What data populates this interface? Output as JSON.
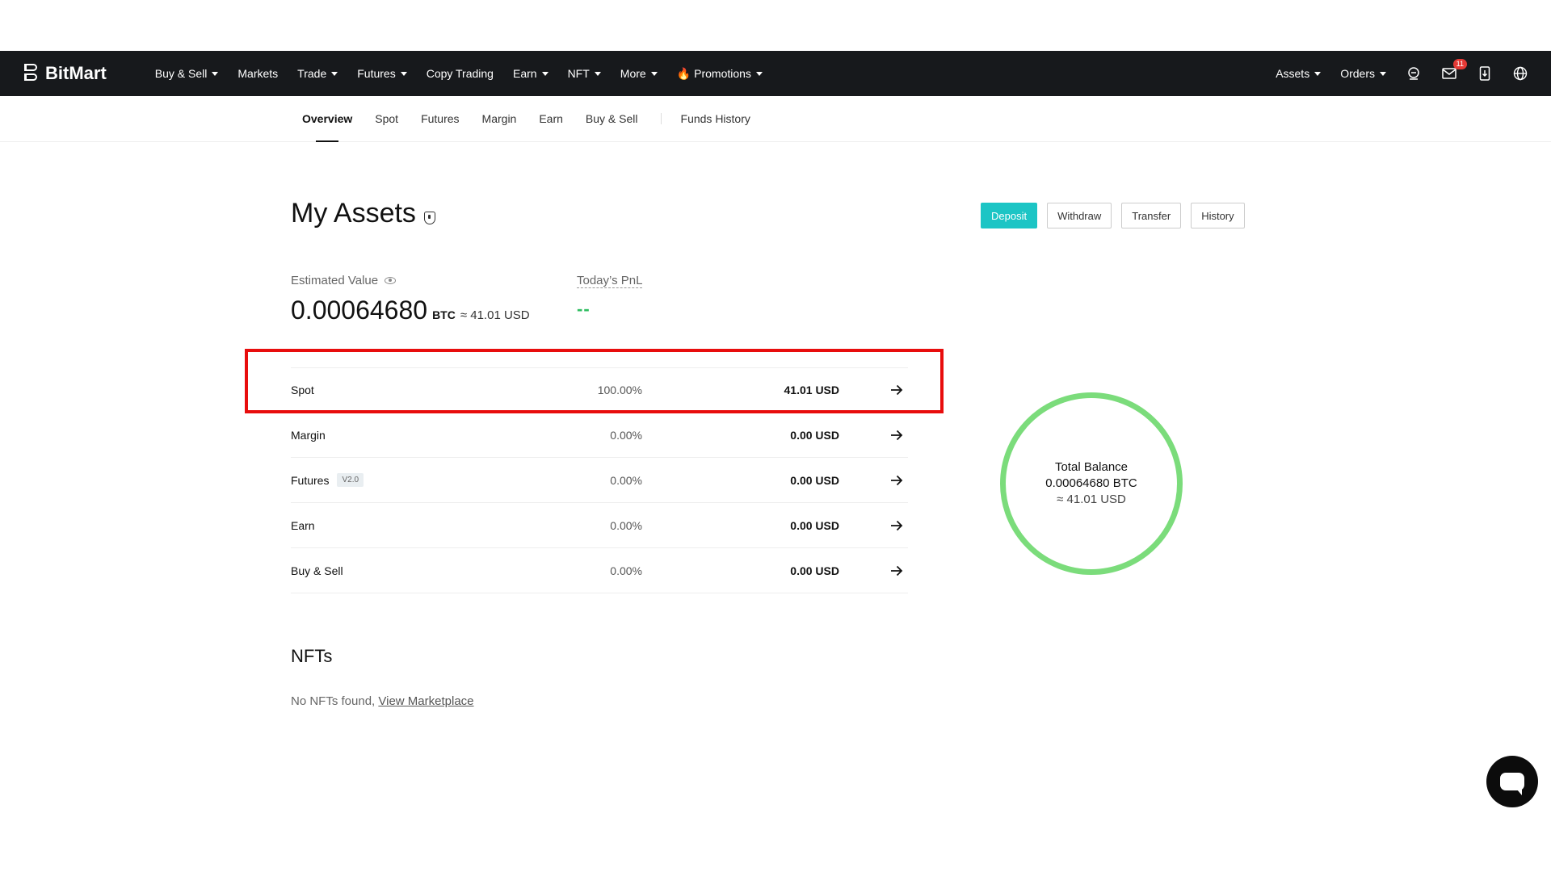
{
  "brand": {
    "name": "BitMart"
  },
  "nav": {
    "items": [
      {
        "label": "Buy & Sell",
        "dropdown": true
      },
      {
        "label": "Markets",
        "dropdown": false
      },
      {
        "label": "Trade",
        "dropdown": true
      },
      {
        "label": "Futures",
        "dropdown": true
      },
      {
        "label": "Copy Trading",
        "dropdown": false
      },
      {
        "label": "Earn",
        "dropdown": true
      },
      {
        "label": "NFT",
        "dropdown": true
      },
      {
        "label": "More",
        "dropdown": true
      },
      {
        "label": "Promotions",
        "dropdown": true,
        "icon": "flame-icon"
      }
    ],
    "right": {
      "assets_label": "Assets",
      "orders_label": "Orders",
      "notification_count": "11",
      "icons": [
        "support-icon",
        "mail-icon",
        "mobile-download-icon",
        "globe-icon"
      ]
    }
  },
  "subnav": {
    "tabs": [
      {
        "label": "Overview",
        "active": true
      },
      {
        "label": "Spot"
      },
      {
        "label": "Futures"
      },
      {
        "label": "Margin"
      },
      {
        "label": "Earn"
      },
      {
        "label": "Buy & Sell"
      }
    ],
    "funds_history": "Funds History"
  },
  "page": {
    "title": "My Assets",
    "actions": {
      "deposit": "Deposit",
      "withdraw": "Withdraw",
      "transfer": "Transfer",
      "history": "History"
    },
    "estimated": {
      "label": "Estimated Value",
      "btc_value": "0.00064680",
      "btc_unit": "BTC",
      "usd_approx": "≈ 41.01 USD"
    },
    "pnl": {
      "label": "Today’s PnL",
      "value": "--"
    },
    "accounts": [
      {
        "name": "Spot",
        "percent": "100.00%",
        "usd": "41.01 USD",
        "highlighted": true
      },
      {
        "name": "Margin",
        "percent": "0.00%",
        "usd": "0.00 USD"
      },
      {
        "name": "Futures",
        "tag": "V2.0",
        "percent": "0.00%",
        "usd": "0.00 USD"
      },
      {
        "name": "Earn",
        "percent": "0.00%",
        "usd": "0.00 USD"
      },
      {
        "name": "Buy & Sell",
        "percent": "0.00%",
        "usd": "0.00 USD"
      }
    ],
    "total_balance": {
      "label": "Total Balance",
      "btc": "0.00064680 BTC",
      "usd": "≈ 41.01 USD",
      "ring_color": "#7bdc7b"
    },
    "nfts": {
      "title": "NFTs",
      "empty_text": "No NFTs found,",
      "link": "View Marketplace"
    }
  },
  "colors": {
    "navbar_bg": "#17191c",
    "accent": "#1cc5c5",
    "pnl": "#2ebd60",
    "highlight": "#e80d0d"
  }
}
